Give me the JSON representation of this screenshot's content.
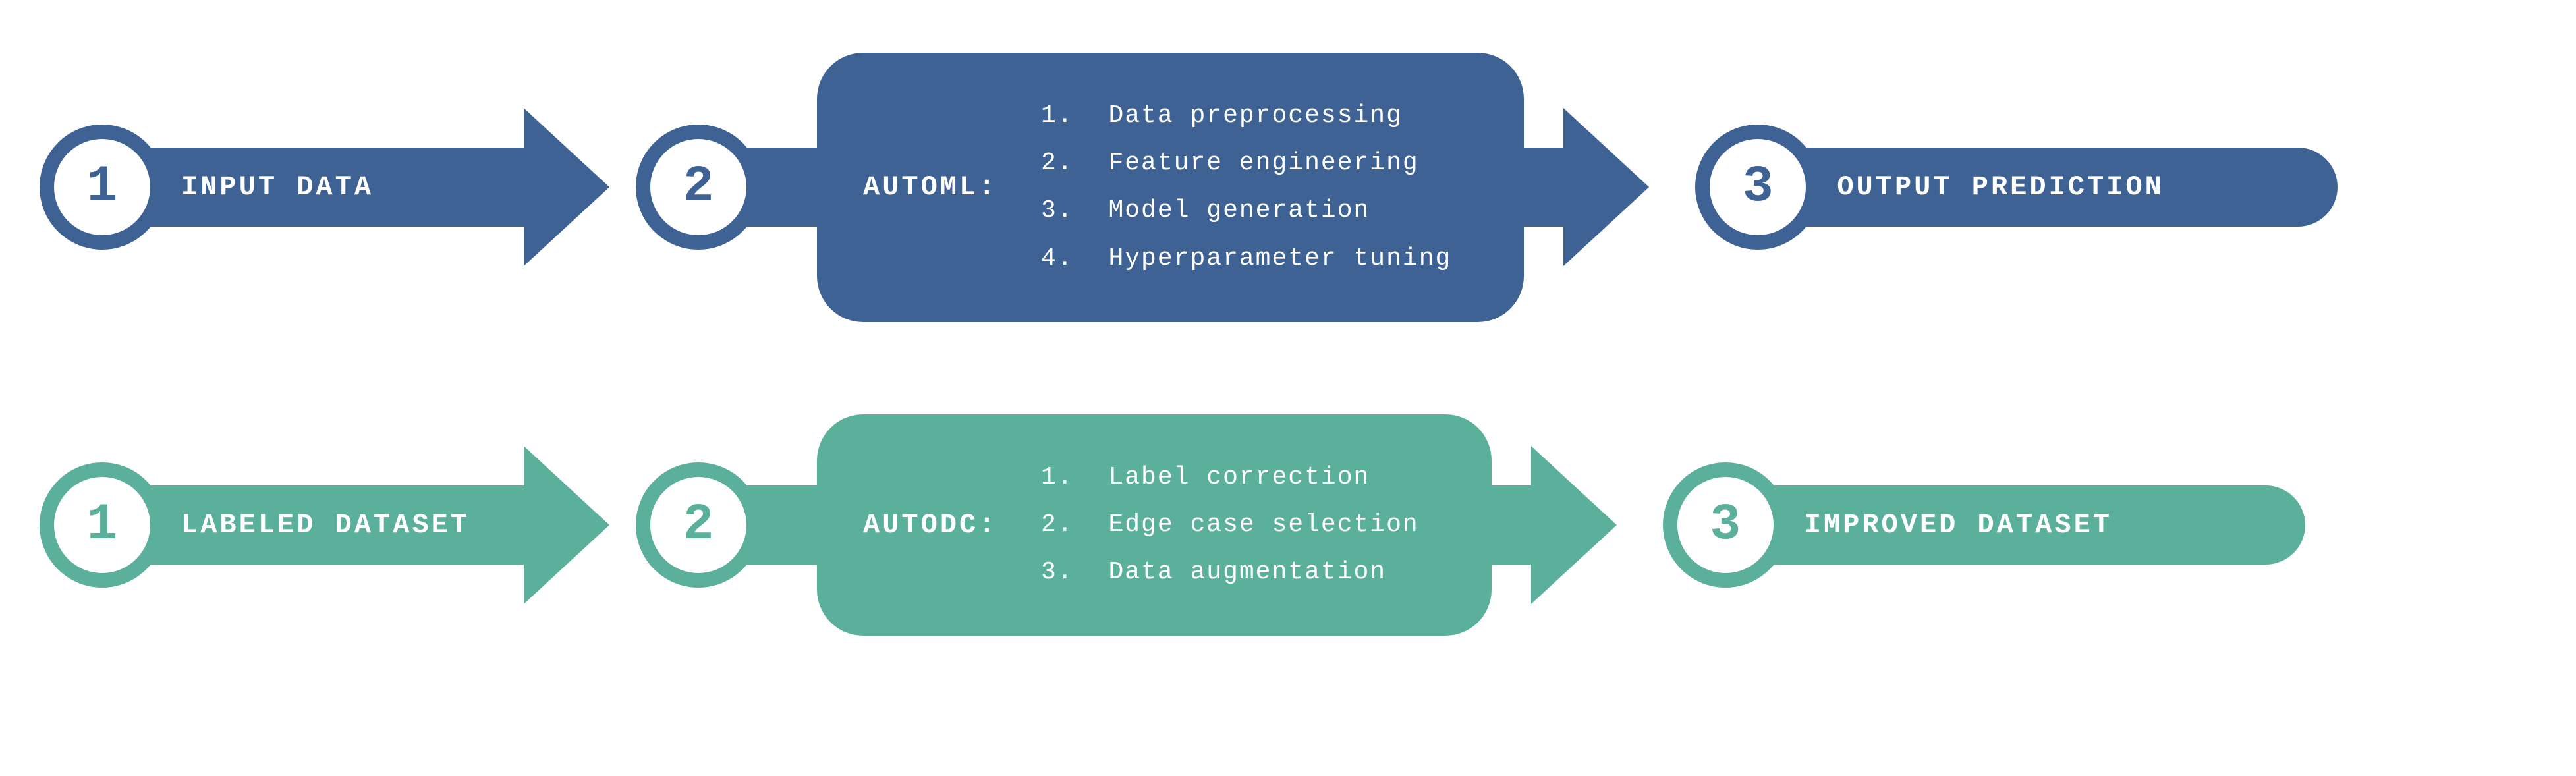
{
  "rows": [
    {
      "variant": "blue",
      "step1": {
        "num": "1",
        "label": "INPUT DATA"
      },
      "step2": {
        "num": "2",
        "title": "AUTOML:",
        "items": [
          "Data preprocessing",
          "Feature engineering",
          "Model generation",
          "Hyperparameter tuning"
        ]
      },
      "step3": {
        "num": "3",
        "label": "OUTPUT PREDICTION"
      }
    },
    {
      "variant": "teal",
      "step1": {
        "num": "1",
        "label": "LABELED DATASET"
      },
      "step2": {
        "num": "2",
        "title": "AUTODC:",
        "items": [
          "Label correction",
          "Edge case selection",
          "Data augmentation"
        ]
      },
      "step3": {
        "num": "3",
        "label": "IMPROVED DATASET"
      }
    }
  ]
}
